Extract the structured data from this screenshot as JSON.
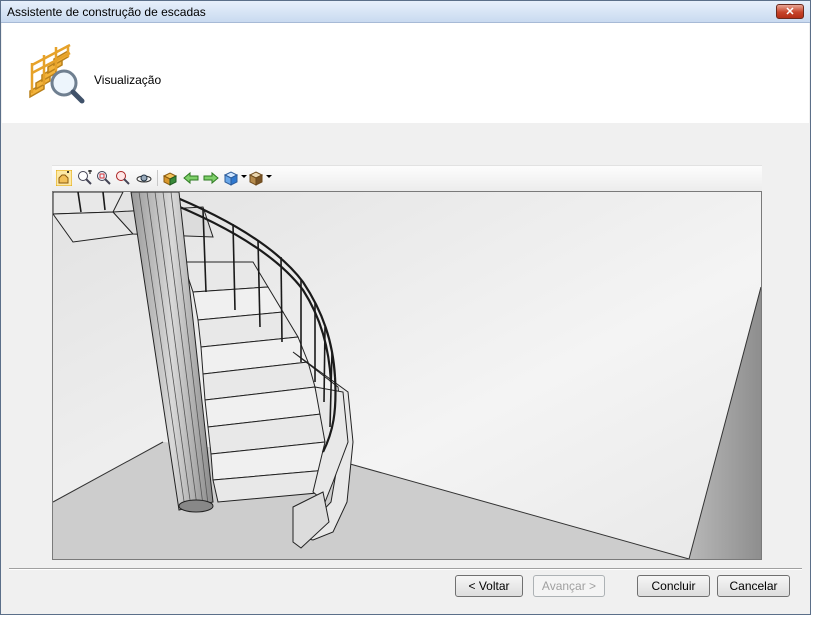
{
  "window": {
    "title": "Assistente de construção de escadas",
    "close_label": "✕"
  },
  "header": {
    "heading": "Visualização",
    "logo_icon": "stair-magnifier-icon"
  },
  "toolbar": {
    "icons": [
      "pan-icon",
      "zoom-window-icon",
      "zoom-extents-icon",
      "zoom-realtime-icon",
      "orbit-icon",
      "render-icon",
      "arrow-left-icon",
      "arrow-right-icon",
      "view-cube-icon",
      "display-mode-icon"
    ]
  },
  "buttons": {
    "back": "< Voltar",
    "next": "Avançar >",
    "finish": "Concluir",
    "cancel": "Cancelar"
  },
  "colors": {
    "accent": "#c7442a",
    "titlebar": "#c9daf0"
  }
}
